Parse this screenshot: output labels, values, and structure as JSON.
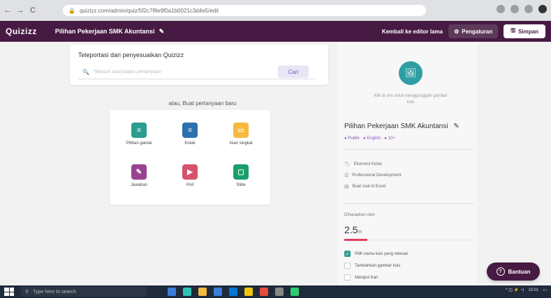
{
  "browser": {
    "url": "quizizz.com/admin/quiz/5f2c7f8e9f0a1b0021c3d4e5/edit",
    "back": "←",
    "forward": "→",
    "reload": "C"
  },
  "header": {
    "logo": "Quizizz",
    "quiz_title": "Pilihan Pekerjaan SMK Akuntansi",
    "edit_icon": "✎",
    "switch_link": "Kembali ke editor lama",
    "settings_label": "Pengaturan",
    "save_label": "Simpan"
  },
  "import": {
    "title": "Teleportasi dari penyesuaikan Quizizz",
    "placeholder": "Telusuri soal jutaan pertanyaan",
    "search_label": "Cari"
  },
  "create": {
    "or_text": "atau, Buat pertanyaan baru",
    "types": [
      {
        "label": "Pilihan ganda",
        "color": "#2a9d8f",
        "glyph": "≡"
      },
      {
        "label": "Kotak",
        "color": "#2d70ae",
        "glyph": "≡"
      },
      {
        "label": "Isian singkat",
        "color": "#f4b93e",
        "glyph": "▭"
      },
      {
        "label": "Jawaban",
        "color": "#9a4292",
        "glyph": "✎"
      },
      {
        "label": "Poll",
        "color": "#d5546d",
        "glyph": "▶"
      },
      {
        "label": "Slide",
        "color": "#1a9e6b",
        "glyph": "▢"
      }
    ]
  },
  "panel": {
    "image_hint": "Klik di sini untuk menggunggah gambar kuis",
    "title": "Pilihan Pekerjaan SMK Akuntansi",
    "title_edit": "✎",
    "meta": "● Publik  ·  ● English  ·  ● 10+",
    "tags": [
      "Ekonomi Kelas",
      "Professional Development",
      "Buat soal di Excel"
    ],
    "estimate_label": "Diharapkan oleh",
    "estimate_value": "2.5",
    "estimate_unit": "m",
    "estimate_fraction": 0.18,
    "checks": [
      {
        "label": "Pilih nama kuis yang relevan",
        "checked": true
      },
      {
        "label": "Tambahkan gambar kuis",
        "checked": false
      },
      {
        "label": "Manipul Kan",
        "checked": false
      }
    ]
  },
  "help": {
    "label": "Bantuan",
    "icon": "?"
  },
  "taskbar": {
    "search_placeholder": "Type here to search",
    "time": "10:01",
    "apps": [
      "#3b7dd8",
      "#2ec4b6",
      "#f4b93e",
      "#3b7dd8",
      "#0078d7",
      "#f1c40f",
      "#e74c3c",
      "#888",
      "#2ecc71"
    ]
  }
}
